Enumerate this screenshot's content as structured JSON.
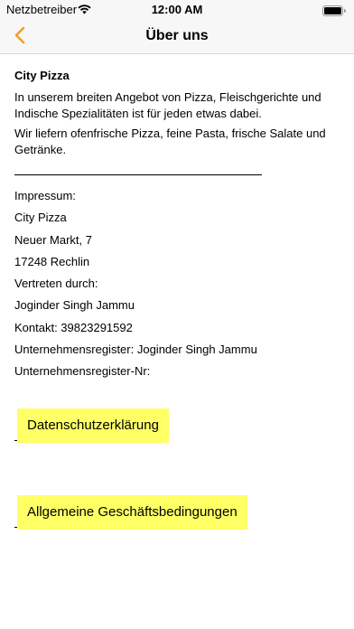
{
  "status_bar": {
    "carrier": "Netzbetreiber",
    "time": "12:00 AM",
    "wifi_icon": "wifi-icon",
    "battery_icon": "battery-icon"
  },
  "nav": {
    "back_icon": "chevron-left-icon",
    "title": "Über uns",
    "accent_color": "#f0a030"
  },
  "about": {
    "company_name": "City Pizza",
    "paragraphs": [
      "In unserem breiten Angebot von Pizza, Fleischgerichte und Indische Spezialitäten ist für jeden etwas dabei.",
      "Wir liefern ofenfrische Pizza, feine Pasta, frische Salate und Getränke."
    ]
  },
  "impressum": {
    "lines": [
      "Impressum:",
      "City Pizza",
      "Neuer Markt, 7",
      "17248 Rechlin",
      "Vertreten durch:",
      "Joginder Singh Jammu",
      "Kontakt: 39823291592",
      "Unternehmensregister: Joginder Singh Jammu",
      "Unternehmensregister-Nr:"
    ]
  },
  "links": {
    "privacy_label": "Datenschutzerklärung",
    "terms_label": "Allgemeine Geschäftsbedingungen",
    "highlight_color": "#ffff66"
  }
}
